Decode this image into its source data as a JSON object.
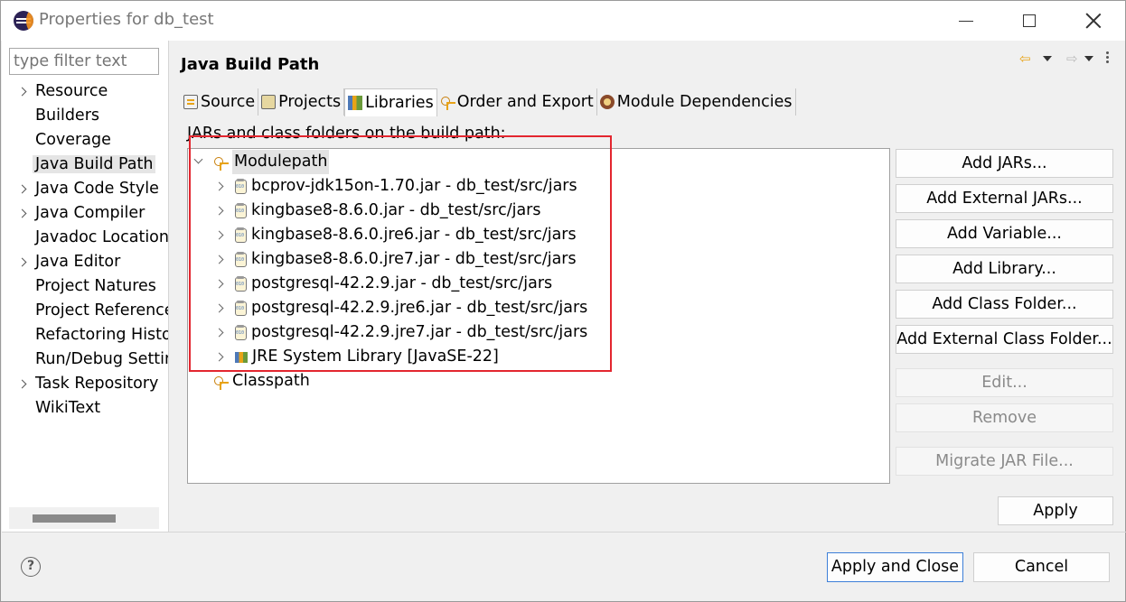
{
  "window": {
    "title": "Properties for db_test"
  },
  "sidebar": {
    "filter_placeholder": "type filter text",
    "items": [
      {
        "label": "Resource",
        "expandable": true
      },
      {
        "label": "Builders",
        "expandable": false
      },
      {
        "label": "Coverage",
        "expandable": false
      },
      {
        "label": "Java Build Path",
        "expandable": false,
        "selected": true
      },
      {
        "label": "Java Code Style",
        "expandable": true
      },
      {
        "label": "Java Compiler",
        "expandable": true
      },
      {
        "label": "Javadoc Location",
        "expandable": false
      },
      {
        "label": "Java Editor",
        "expandable": true
      },
      {
        "label": "Project Natures",
        "expandable": false
      },
      {
        "label": "Project References",
        "expandable": false
      },
      {
        "label": "Refactoring History",
        "expandable": false
      },
      {
        "label": "Run/Debug Settings",
        "expandable": false
      },
      {
        "label": "Task Repository",
        "expandable": true
      },
      {
        "label": "WikiText",
        "expandable": false
      }
    ]
  },
  "page": {
    "title": "Java Build Path",
    "tabs": [
      {
        "label": "Source",
        "icon": "source-folder-icon"
      },
      {
        "label": "Projects",
        "icon": "project-icon"
      },
      {
        "label": "Libraries",
        "icon": "library-icon",
        "active": true
      },
      {
        "label": "Order and Export",
        "icon": "order-icon"
      },
      {
        "label": "Module Dependencies",
        "icon": "module-icon"
      }
    ],
    "description": "JARs and class folders on the build path:",
    "tree": {
      "modulepath": {
        "label": "Modulepath",
        "children": [
          {
            "label": "bcprov-jdk15on-1.70.jar - db_test/src/jars",
            "icon": "jar-icon"
          },
          {
            "label": "kingbase8-8.6.0.jar - db_test/src/jars",
            "icon": "jar-icon"
          },
          {
            "label": "kingbase8-8.6.0.jre6.jar - db_test/src/jars",
            "icon": "jar-icon"
          },
          {
            "label": "kingbase8-8.6.0.jre7.jar - db_test/src/jars",
            "icon": "jar-icon"
          },
          {
            "label": "postgresql-42.2.9.jar - db_test/src/jars",
            "icon": "jar-icon"
          },
          {
            "label": "postgresql-42.2.9.jre6.jar - db_test/src/jars",
            "icon": "jar-icon"
          },
          {
            "label": "postgresql-42.2.9.jre7.jar - db_test/src/jars",
            "icon": "jar-icon"
          },
          {
            "label": "JRE System Library [JavaSE-22]",
            "icon": "jre-library-icon"
          }
        ]
      },
      "classpath": {
        "label": "Classpath"
      }
    },
    "buttons": {
      "add_jars": "Add JARs...",
      "add_external_jars": "Add External JARs...",
      "add_variable": "Add Variable...",
      "add_library": "Add Library...",
      "add_class_folder": "Add Class Folder...",
      "add_external_class_folder": "Add External Class Folder...",
      "edit": "Edit...",
      "remove": "Remove",
      "migrate_jar": "Migrate JAR File..."
    },
    "apply": "Apply"
  },
  "footer": {
    "help": "?",
    "apply_and_close": "Apply and Close",
    "cancel": "Cancel"
  },
  "colors": {
    "highlight_box": "#e3262f",
    "default_button_border": "#3c7fd8"
  }
}
